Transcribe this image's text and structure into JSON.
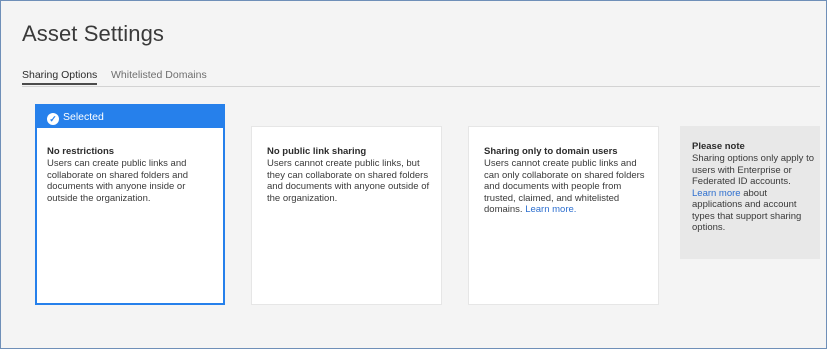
{
  "page": {
    "title": "Asset Settings"
  },
  "tabs": [
    {
      "label": "Sharing Options",
      "active": true
    },
    {
      "label": "Whitelisted Domains",
      "active": false
    }
  ],
  "options": [
    {
      "selected_label": "Selected",
      "title": "No restrictions",
      "description": "Users can create public links and collaborate on shared folders and documents with anyone inside or outside the organization."
    },
    {
      "title": "No public link sharing",
      "description": "Users cannot create public links, but they can collaborate on shared folders and documents with anyone outside of the organization."
    },
    {
      "title": "Sharing only to domain users",
      "description": "Users cannot create public links and can only collaborate on shared folders and documents with people from trusted, claimed, and whitelisted domains.",
      "link": "Learn more."
    }
  ],
  "note": {
    "title": "Please note",
    "text_before": "Sharing options only apply to users with Enterprise or Federated ID accounts.",
    "link": "Learn more",
    "text_after": "about applications and account types that support sharing options."
  },
  "colors": {
    "accent": "#2680eb",
    "link": "#2d6fcf"
  }
}
